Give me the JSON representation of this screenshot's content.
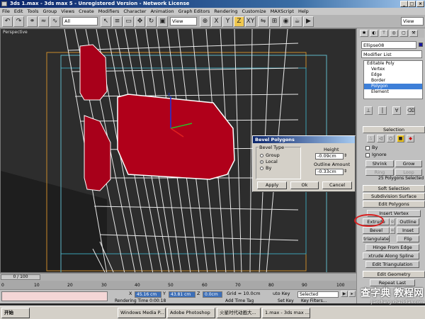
{
  "window": {
    "title": "3ds 1.max - 3ds max 5 - Unregistered Version - Network License"
  },
  "menu": [
    "File",
    "Edit",
    "Tools",
    "Group",
    "Views",
    "Create",
    "Modifiers",
    "Character",
    "Animation",
    "Graph Editors",
    "Rendering",
    "Customize",
    "MAXScript",
    "Help"
  ],
  "toolbar": {
    "selection_filter": "All",
    "ref_coord": "View",
    "axis_x": "X",
    "axis_y": "Y",
    "axis_z": "Z",
    "axis_xy": "XY",
    "named_sel": "View"
  },
  "viewport": {
    "label": "Perspective"
  },
  "command_panel": {
    "object_name": "Ellipse08",
    "modifier_list": "Modifier List",
    "stack": [
      "Editable Poly",
      "Vertex",
      "Edge",
      "Border",
      "Polygon",
      "Element"
    ],
    "stack_selected": "Polygon",
    "selection": {
      "header": "Selection",
      "by_label": "By",
      "ignore_label": "Ignore",
      "shrink": "Shrink",
      "grow": "Grow",
      "ring": "Ring",
      "loop": "Loop",
      "status": "25 Polygons Selected"
    },
    "soft_selection": "Soft Selection",
    "subdivision_surface": "Subdivision Surface",
    "edit_polygons": {
      "header": "Edit Polygons",
      "insert_vertex": "Insert Vertex",
      "extrude": "Extrude",
      "outline": "Outline",
      "bevel": "Bevel",
      "inset": "Inset",
      "retriangulate": "triangulate",
      "flip": "Flip",
      "hinge": "Hinge From Edge",
      "extrude_spline": "xtrude Along Spline",
      "edit_tri": "Edit Triangulation"
    },
    "edit_geometry": {
      "header": "Edit Geometry",
      "repeat_last": "Repeat Last"
    }
  },
  "bevel_dialog": {
    "title": "Bevel Polygons",
    "bevel_type": "Bevel Type",
    "group": "Group",
    "local": "Local",
    "by": "By",
    "height_label": "Height",
    "height_value": "-0.09cm",
    "outline_label": "Outline Amount",
    "outline_value": "-0.33cm",
    "apply": "Apply",
    "ok": "Ok",
    "cancel": "Cancel"
  },
  "timeline": {
    "frame": "0 / 100",
    "ticks": [
      "0",
      "10",
      "20",
      "30",
      "40",
      "50",
      "60",
      "70",
      "80",
      "90",
      "100"
    ]
  },
  "status": {
    "x_label": "X",
    "x_value": "45.16 cm",
    "y_label": "Y",
    "y_value": "43.81 cm",
    "z_label": "Z",
    "z_value": "0.0cm",
    "grid": "Grid = 10.0cm",
    "auto_key": "uto Key",
    "selected": "Selected",
    "rendering_time": "Rendering Time  0:00:18",
    "add_time_tag": "Add Time Tag",
    "set_key": "Set Key",
    "key_filters": "Key Filters..."
  },
  "taskbar": {
    "start": "开始",
    "tasks": [
      "Windows Media P...",
      "Adobe Photoshop",
      "火星时代动画大...",
      "1.max - 3ds max ..."
    ]
  },
  "watermark": {
    "text": "查字典 教程网",
    "url": "jiaocheng.chazidian.com"
  }
}
